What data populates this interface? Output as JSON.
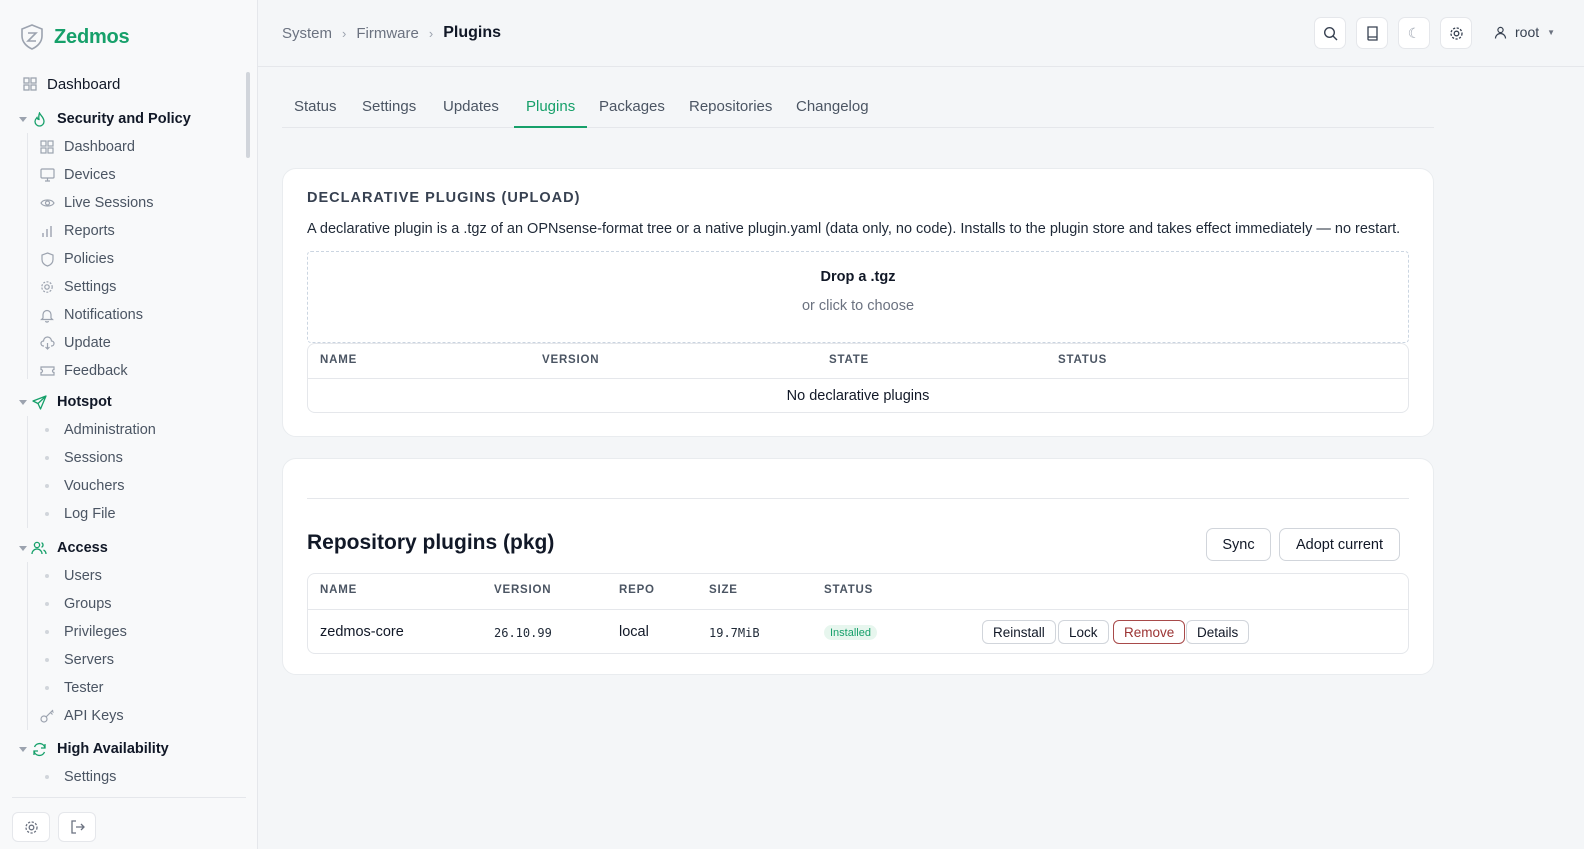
{
  "brand": {
    "name": "Zedmos"
  },
  "sidebar": {
    "top": {
      "label": "Dashboard",
      "icon": "grid-icon"
    },
    "groups": [
      {
        "label": "Security and Policy",
        "icon": "flame-icon",
        "items": [
          "Dashboard",
          "Devices",
          "Live Sessions",
          "Reports",
          "Policies",
          "Settings",
          "Notifications",
          "Update",
          "Feedback"
        ]
      },
      {
        "label": "Hotspot",
        "icon": "send-icon",
        "items": [
          "Administration",
          "Sessions",
          "Vouchers",
          "Log File"
        ]
      },
      {
        "label": "Access",
        "icon": "users-icon",
        "items": [
          "Users",
          "Groups",
          "Privileges",
          "Servers",
          "Tester",
          "API Keys"
        ]
      },
      {
        "label": "High Availability",
        "icon": "refresh-icon",
        "items": [
          "Settings"
        ]
      }
    ]
  },
  "breadcrumb": {
    "items": [
      "System",
      "Firmware"
    ],
    "current": "Plugins"
  },
  "header": {
    "user": "root"
  },
  "tabs": [
    "Status",
    "Settings",
    "Updates",
    "Plugins",
    "Packages",
    "Repositories",
    "Changelog"
  ],
  "active_tab": "Plugins",
  "declarative": {
    "title": "DECLARATIVE PLUGINS (UPLOAD)",
    "description": "A declarative plugin is a .tgz of an OPNsense-format tree or a native plugin.yaml (data only, no code). Installs to the plugin store and takes effect immediately — no restart.",
    "drop_title": "Drop a .tgz",
    "drop_sub": "or click to choose",
    "columns": [
      "NAME",
      "VERSION",
      "STATE",
      "STATUS"
    ],
    "empty": "No declarative plugins"
  },
  "repository": {
    "title": "Repository plugins (pkg)",
    "sync_label": "Sync",
    "adopt_label": "Adopt current",
    "columns": [
      "NAME",
      "VERSION",
      "REPO",
      "SIZE",
      "STATUS"
    ],
    "rows": [
      {
        "name": "zedmos-core",
        "version": "26.10.99",
        "repo": "local",
        "size": "19.7MiB",
        "status": "Installed",
        "actions": [
          "Reinstall",
          "Lock",
          "Remove",
          "Details"
        ]
      }
    ]
  },
  "colors": {
    "accent": "#16a06a",
    "danger": "#9b3333"
  }
}
